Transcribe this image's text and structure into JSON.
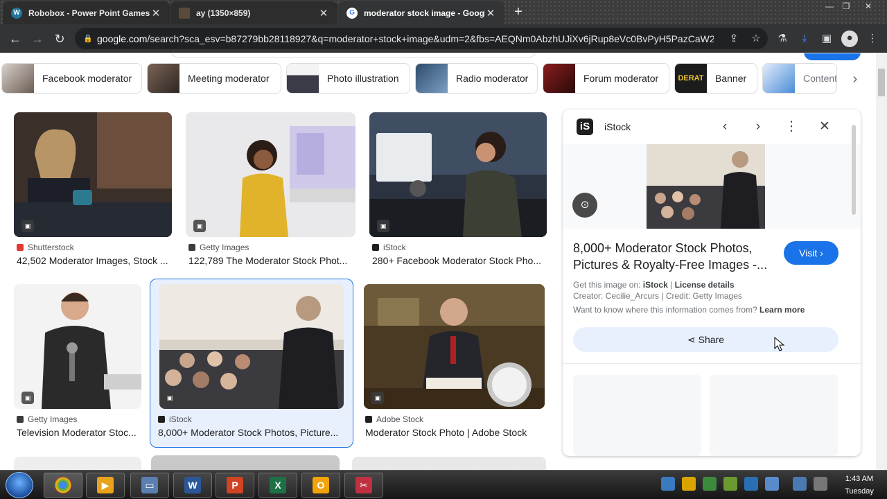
{
  "tabs": [
    {
      "title": "Robobox - Power Point Games",
      "favicon": "wordpress-icon",
      "color": "#21759b"
    },
    {
      "title": "ay (1350×859)",
      "favicon": "image-thumb-icon",
      "color": "#5a4a3a"
    },
    {
      "title": "moderator stock image - Google",
      "favicon": "google-icon",
      "color": "#ffffff"
    }
  ],
  "address": {
    "url_domain": "google.com",
    "url_rest": "/search?sca_esv=b87279bb28118927&q=moderator+stock+image&udm=2&fbs=AEQNm0AbzhUJiXv6jRup8eVc0BvPyH5PazCaW2..."
  },
  "chips": [
    {
      "label": "Facebook moderator"
    },
    {
      "label": "Meeting moderator"
    },
    {
      "label": "Photo illustration"
    },
    {
      "label": "Radio moderator"
    },
    {
      "label": "Forum moderator"
    },
    {
      "label": "Banner",
      "thumb_text": "DERAT"
    },
    {
      "label": "Content"
    }
  ],
  "results": [
    {
      "source": "Shutterstock",
      "title": "42,502 Moderator Images, Stock ...",
      "fav": "#e53935"
    },
    {
      "source": "Getty Images",
      "title": "122,789 The Moderator Stock Phot...",
      "fav": "#3c3c3c"
    },
    {
      "source": "iStock",
      "title": "280+ Facebook Moderator Stock Pho...",
      "fav": "#1f1f1f"
    },
    {
      "source": "Getty Images",
      "title": "Television Moderator Stoc...",
      "fav": "#3c3c3c"
    },
    {
      "source": "iStock",
      "title": "8,000+ Moderator Stock Photos, Picture...",
      "fav": "#1f1f1f"
    },
    {
      "source": "Adobe Stock",
      "title": "Moderator Stock Photo | Adobe Stock",
      "fav": "#1f1f1f"
    }
  ],
  "panel": {
    "logo_letter": "iS",
    "site_name": "iStock",
    "title": "8,000+ Moderator Stock Photos, Pictures & Royalty-Free Images -...",
    "visit_label": "Visit",
    "get_image_prefix": "Get this image on:",
    "get_image_site": "iStock",
    "separator": "|",
    "license_label": "License details",
    "credit_line": "Creator: Cecilie_Arcurs | Credit: Getty Images",
    "learn_prefix": "Want to know where this information comes from?",
    "learn_link": "Learn more",
    "share_label": "Share"
  },
  "taskbar": {
    "time": "1:43 AM",
    "day": "Tuesday"
  },
  "colors": {
    "accent": "#1a73e8",
    "chrome_dark": "#333436"
  }
}
